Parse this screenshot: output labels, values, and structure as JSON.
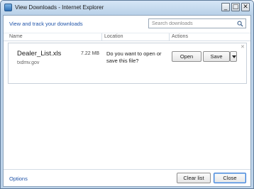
{
  "window": {
    "title": "View Downloads - Internet Explorer",
    "controls": {
      "minimize": "_",
      "maximize": "□",
      "close": "✕"
    }
  },
  "header": {
    "track_link": "View and track your downloads",
    "search_placeholder": "Search downloads"
  },
  "columns": [
    "Name",
    "Location",
    "Actions"
  ],
  "download": {
    "filename": "Dealer_List.xls",
    "size": "7.22 MB",
    "source": "txdmv.gov",
    "prompt": "Do you want to open or save this file?",
    "open_label": "Open",
    "save_label": "Save"
  },
  "footer": {
    "options_label": "Options",
    "clear_label": "Clear list",
    "close_label": "Close"
  },
  "colors": {
    "link": "#1f53a8",
    "frame": "#bcd3ea",
    "accent_border": "#3a7bd5"
  }
}
